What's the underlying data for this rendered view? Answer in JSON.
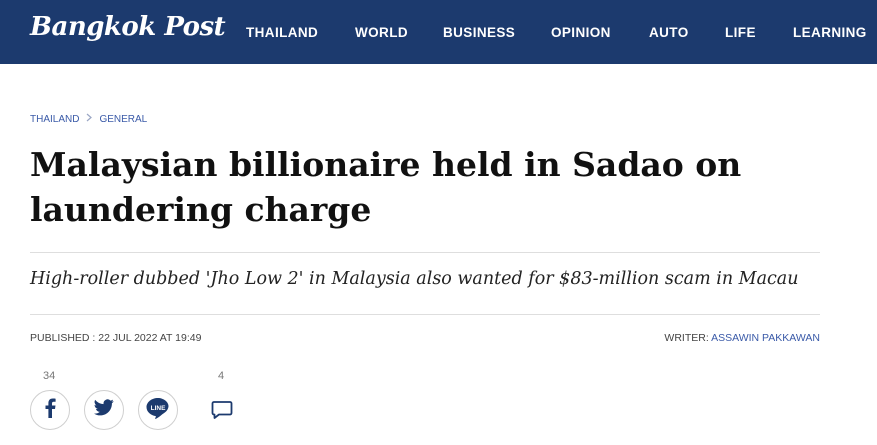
{
  "brand": {
    "logo_text": "Bangkok Post",
    "header_color": "#1c3a6e",
    "link_color": "#3a5aa8"
  },
  "nav": {
    "items": [
      "THAILAND",
      "WORLD",
      "BUSINESS",
      "OPINION",
      "AUTO",
      "LIFE",
      "LEARNING"
    ]
  },
  "breadcrumb": {
    "items": [
      "THAILAND",
      "GENERAL"
    ],
    "separator_icon": "chevron-right-icon"
  },
  "article": {
    "headline_line1": "Malaysian billionaire held in Sadao on",
    "headline_line2": "laundering charge",
    "subheadline": "High-roller dubbed 'Jho Low 2' in Malaysia also wanted for $83-million scam in Macau",
    "published_label": "PUBLISHED : ",
    "published_date": "22 JUL 2022 AT 19:49",
    "writer_label": "WRITER: ",
    "writer_name": "ASSAWIN PAKKAWAN"
  },
  "share": {
    "facebook_count": "34",
    "comment_count": "4",
    "icons": [
      "facebook-icon",
      "twitter-icon",
      "line-icon",
      "comment-icon"
    ]
  }
}
